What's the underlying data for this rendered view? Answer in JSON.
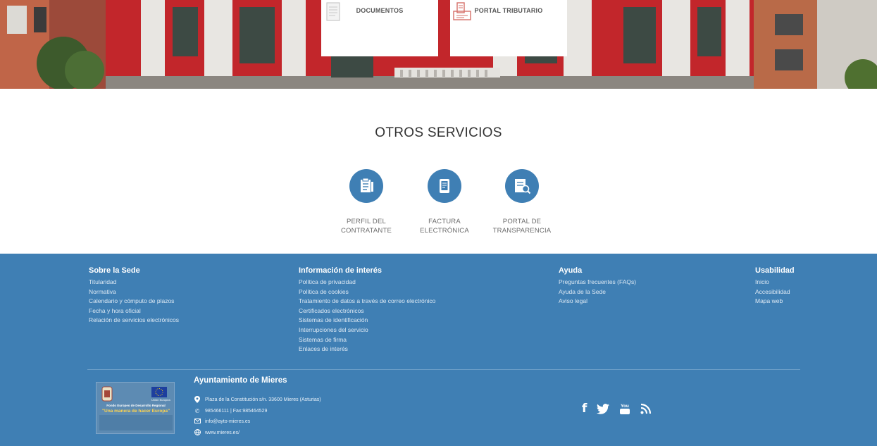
{
  "hero": {
    "cards": [
      {
        "title": "DOCUMENTOS",
        "icon": "document-icon"
      },
      {
        "title": "PORTAL TRIBUTARIO",
        "icon": "tax-portal-icon"
      }
    ]
  },
  "otros_servicios": {
    "title": "OTROS SERVICIOS",
    "items": [
      {
        "label": "PERFIL DEL\nCONTRATANTE",
        "icon": "contract-profile-icon"
      },
      {
        "label": "FACTURA\nELECTRÓNICA",
        "icon": "e-invoice-icon"
      },
      {
        "label": "PORTAL DE\nTRANSPARENCIA",
        "icon": "transparency-icon"
      }
    ]
  },
  "footer": {
    "columns": [
      {
        "title": "Sobre la Sede",
        "links": [
          "Titularidad",
          "Normativa",
          "Calendario y cómputo de plazos",
          "Fecha y hora oficial",
          "Relación de servicios electrónicos"
        ]
      },
      {
        "title": "Información de interés",
        "links": [
          "Política de privacidad",
          "Política de cookies",
          "Tratamiento de datos a través de correo electrónico",
          "Certificados electrónicos",
          "Sistemas de identificación",
          "Interrupciones del servicio",
          "Sistemas de firma",
          "Enlaces de interés"
        ]
      },
      {
        "title": "Ayuda",
        "links": [
          "Preguntas frecuentes (FAQs)",
          "Ayuda de la Sede",
          "Aviso legal"
        ]
      },
      {
        "title": "Usabilidad",
        "links": [
          "Inicio",
          "Accesibilidad",
          "Mapa web"
        ]
      }
    ],
    "logo": {
      "line1": "Fondo Europeo de Desarrollo Regional",
      "line2": "\"Una manera de hacer Europa\"",
      "eu_label": "Unión Europea"
    },
    "org_name": "Ayuntamiento de Mieres",
    "contact": {
      "address": "Plaza de la Constitución s/n. 33600 Mieres (Asturias)",
      "phone": "985466111 | Fax:985464529",
      "email": "info@ayto-mieres.es",
      "web": "www.mieres.es/"
    },
    "social": [
      "facebook-icon",
      "twitter-icon",
      "youtube-icon",
      "rss-icon"
    ],
    "colors": {
      "footer_bg": "#3f7fb4",
      "service_circle": "#3f7fb4",
      "facade_red": "#c2262b"
    }
  }
}
